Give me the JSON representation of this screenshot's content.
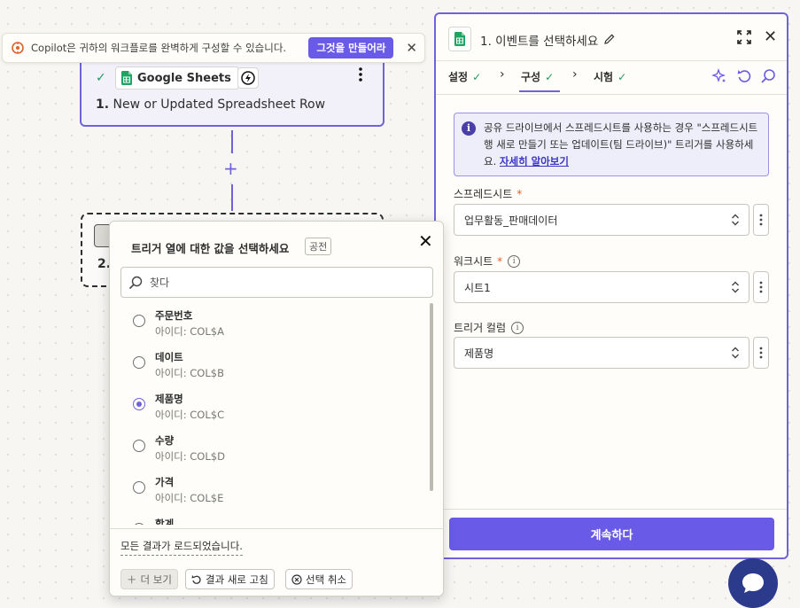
{
  "copilot": {
    "text": "Copilot은 귀하의 워크플로를 완벽하게 구성할 수 있습니다.",
    "button": "그것을 만들어라",
    "close": "✕"
  },
  "step1": {
    "app_name": "Google Sheets",
    "title_num": "1.",
    "title": "New or Updated Spreadsheet Row",
    "menu": "⋮"
  },
  "step2": {
    "num": "2."
  },
  "popup": {
    "title": "트리거 열에  대한 값을 선택하세요",
    "badge": "공전",
    "close": "✕",
    "search_placeholder": "찾다",
    "items": [
      {
        "name": "주문번호",
        "id": "아이디: COL$A",
        "selected": false
      },
      {
        "name": "데이트",
        "id": "아이디: COL$B",
        "selected": false
      },
      {
        "name": "제품명",
        "id": "아이디: COL$C",
        "selected": true
      },
      {
        "name": "수량",
        "id": "아이디: COL$D",
        "selected": false
      },
      {
        "name": "가격",
        "id": "아이디: COL$E",
        "selected": false
      },
      {
        "name": "합계",
        "id": "",
        "selected": false
      }
    ],
    "loaded_text": "모든 결과가 로드되었습니다.",
    "more_button": "더 보기",
    "refresh_button": "결과 새로 고침",
    "clear_button": "선택 취소"
  },
  "panel": {
    "title": "1. 이벤트를 선택하세요",
    "close": "✕",
    "tabs": [
      {
        "label": "설정",
        "done": true
      },
      {
        "label": "구성",
        "done": true,
        "active": true
      },
      {
        "label": "시험",
        "done": true
      }
    ],
    "info_text": "공유 드라이브에서 스프레드시트를 사용하는 경우 \"스프레드시트 행 새로 만들기 또는 업데이트(팀 드라이브)\" 트리거를 사용하세요.",
    "info_link": "자세히 알아보기",
    "fields": {
      "spreadsheet": {
        "label": "스프레드시트",
        "required": true,
        "value": "업무활동_판매데이터"
      },
      "worksheet": {
        "label": "워크시트",
        "required": true,
        "value": "시트1"
      },
      "trigger_column": {
        "label": "트리거 컬럼",
        "required": false,
        "value": "제품명"
      }
    },
    "continue_button": "계속하다"
  },
  "colors": {
    "accent": "#695be8",
    "border_active": "#6f63d8",
    "check_green": "#1e9a61",
    "chat_bubble": "#2c3a8c"
  }
}
